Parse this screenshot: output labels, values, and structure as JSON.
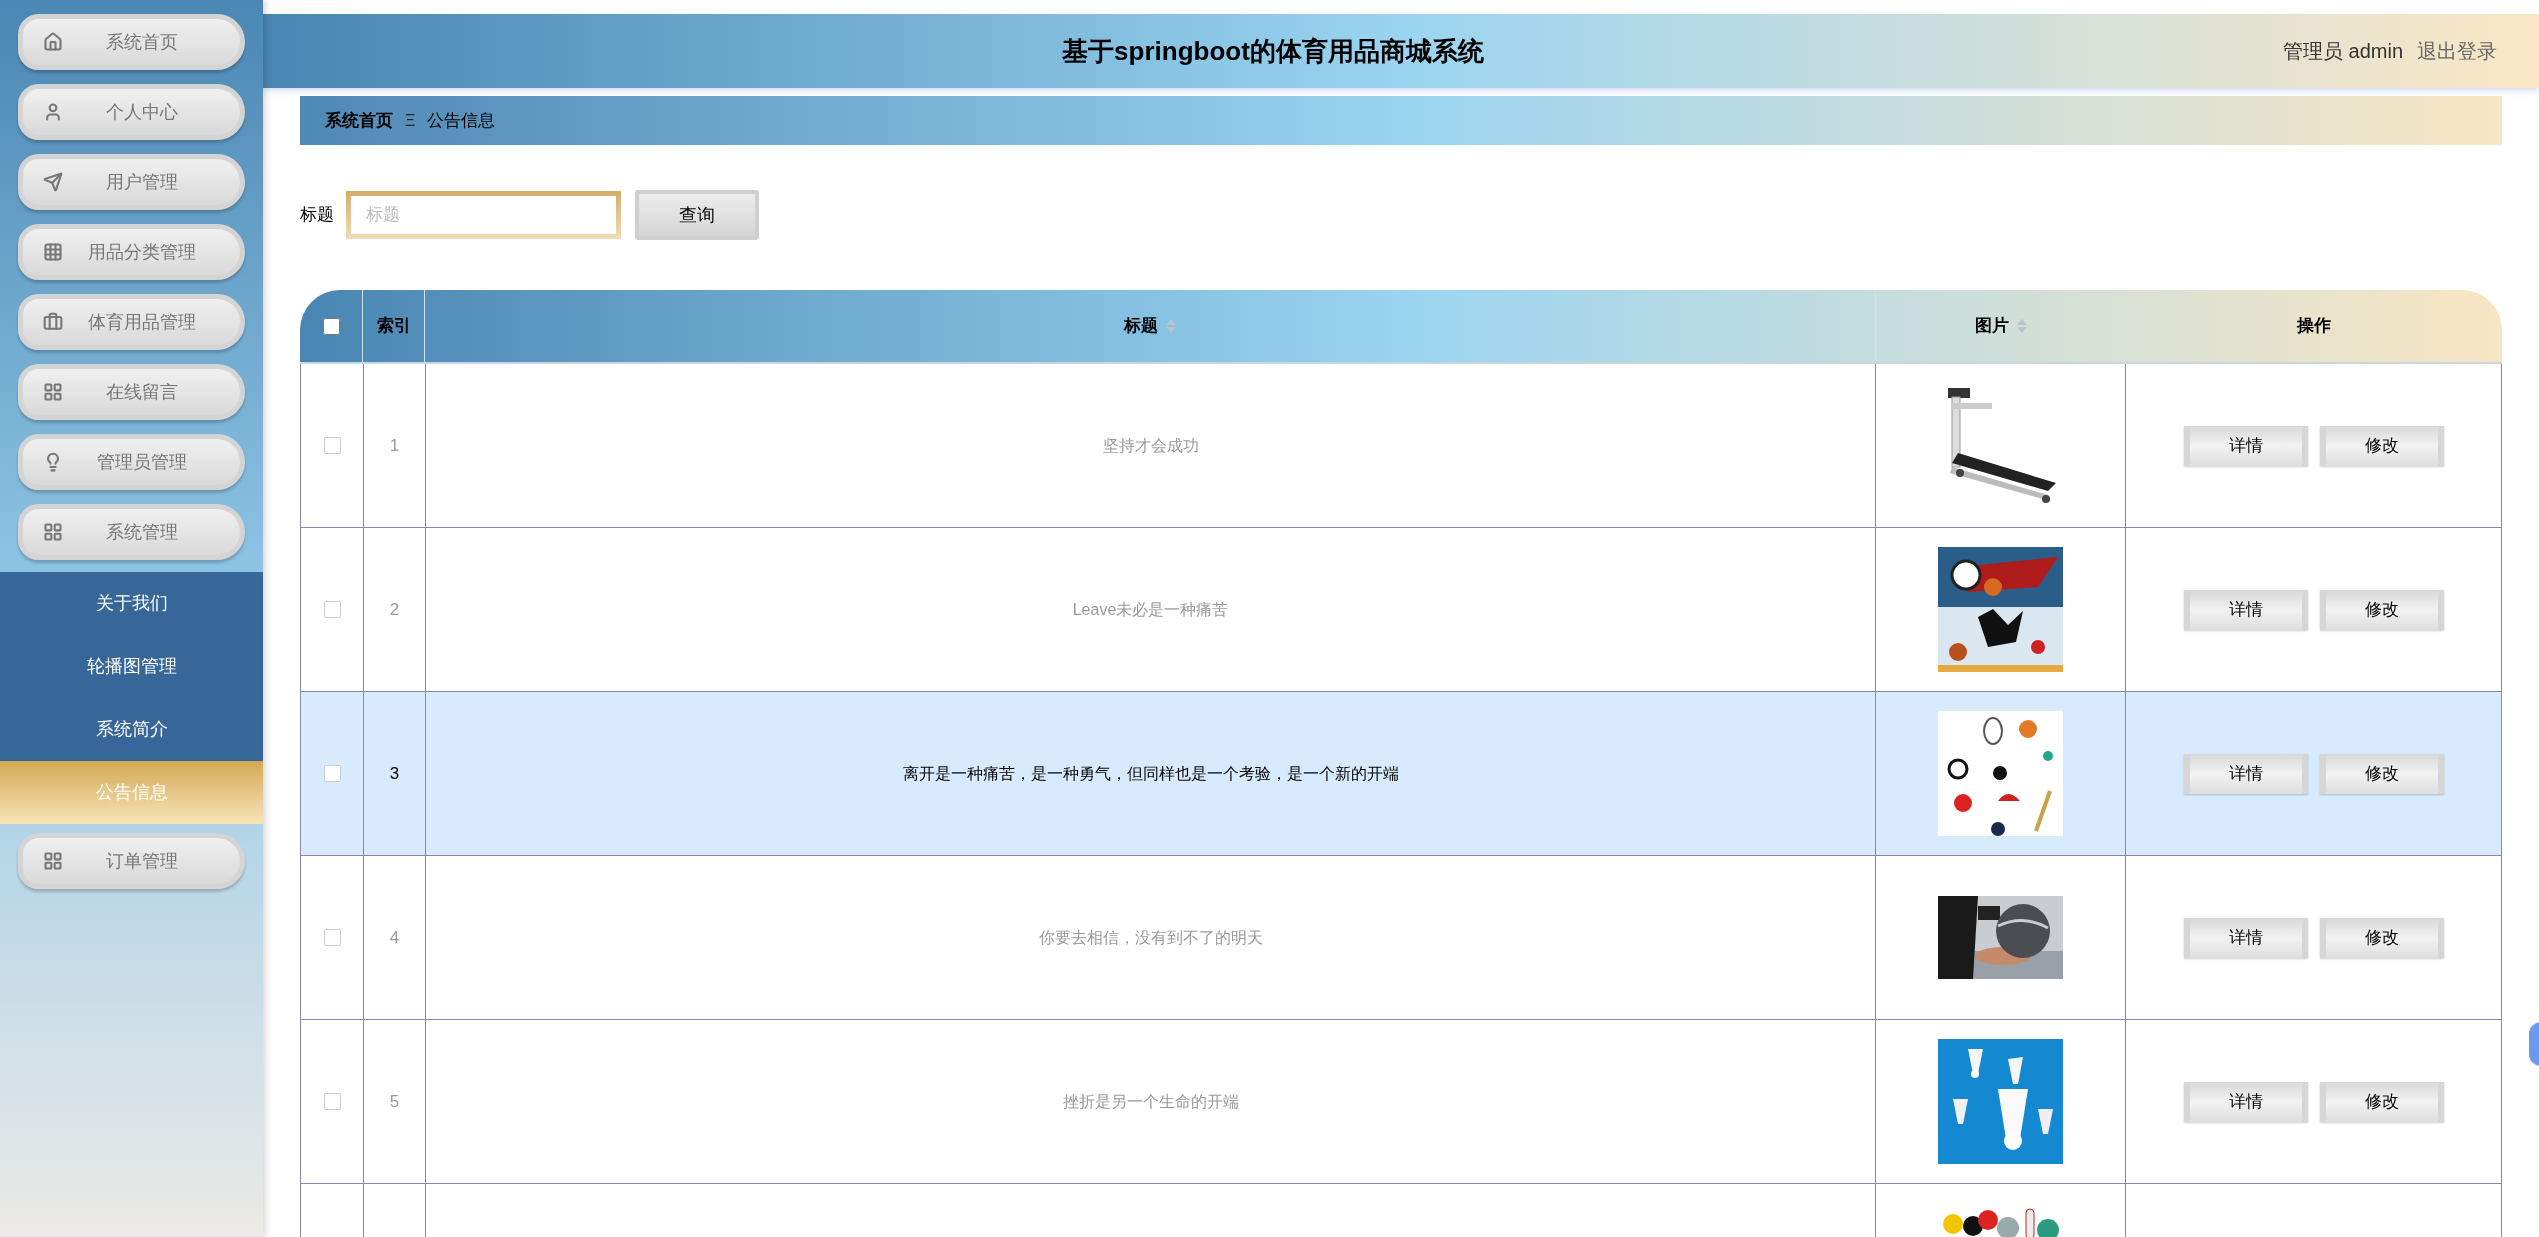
{
  "sidebar": {
    "items": [
      {
        "label": "系统首页",
        "selected": false
      },
      {
        "label": "个人中心",
        "selected": false
      },
      {
        "label": "用户管理",
        "selected": false
      },
      {
        "label": "用品分类管理",
        "selected": false
      },
      {
        "label": "体育用品管理",
        "selected": false
      },
      {
        "label": "在线留言",
        "selected": false
      },
      {
        "label": "管理员管理",
        "selected": false
      },
      {
        "label": "系统管理",
        "selected": false,
        "expanded": true,
        "children": [
          {
            "label": "关于我们",
            "selected": false
          },
          {
            "label": "轮播图管理",
            "selected": false
          },
          {
            "label": "系统简介",
            "selected": false
          },
          {
            "label": "公告信息",
            "selected": true
          }
        ]
      },
      {
        "label": "订单管理",
        "selected": false
      }
    ]
  },
  "header": {
    "title": "基于springboot的体育用品商城系统",
    "user": "管理员 admin",
    "logout": "退出登录"
  },
  "breadcrumb": [
    {
      "label": "系统首页",
      "current": false
    },
    {
      "label": "公告信息",
      "current": true
    }
  ],
  "breadcrumb_separator": "Ξ",
  "search": {
    "label": "标题",
    "placeholder": "标题",
    "button": "查询"
  },
  "table": {
    "columns": [
      {
        "kind": "checkbox",
        "checked": false
      },
      {
        "kind": "text",
        "label": "索引",
        "sortable": false
      },
      {
        "kind": "text",
        "label": "标题",
        "sortable": true
      },
      {
        "kind": "text",
        "label": "图片",
        "sortable": true
      },
      {
        "kind": "text",
        "label": "操作",
        "sortable": false
      }
    ],
    "rows": [
      {
        "kind": "full",
        "index": "1",
        "title": "坚持才会成功",
        "checked": false,
        "selected": false,
        "actions": [
          "详情",
          "修改"
        ]
      },
      {
        "kind": "full",
        "index": "2",
        "title": "Leave未必是一种痛苦",
        "checked": false,
        "selected": false,
        "actions": [
          "详情",
          "修改"
        ]
      },
      {
        "kind": "full",
        "index": "3",
        "title": "离开是一种痛苦，是一种勇气，但同样也是一个考验，是一个新的开端",
        "checked": false,
        "selected": true,
        "actions": [
          "详情",
          "修改"
        ]
      },
      {
        "kind": "full",
        "index": "4",
        "title": "你要去相信，没有到不了的明天",
        "checked": false,
        "selected": false,
        "actions": [
          "详情",
          "修改"
        ]
      },
      {
        "kind": "full",
        "index": "5",
        "title": "挫折是另一个生命的开端",
        "checked": false,
        "selected": false,
        "actions": [
          "详情",
          "修改"
        ]
      },
      {
        "kind": "partial",
        "selected": false
      }
    ]
  }
}
